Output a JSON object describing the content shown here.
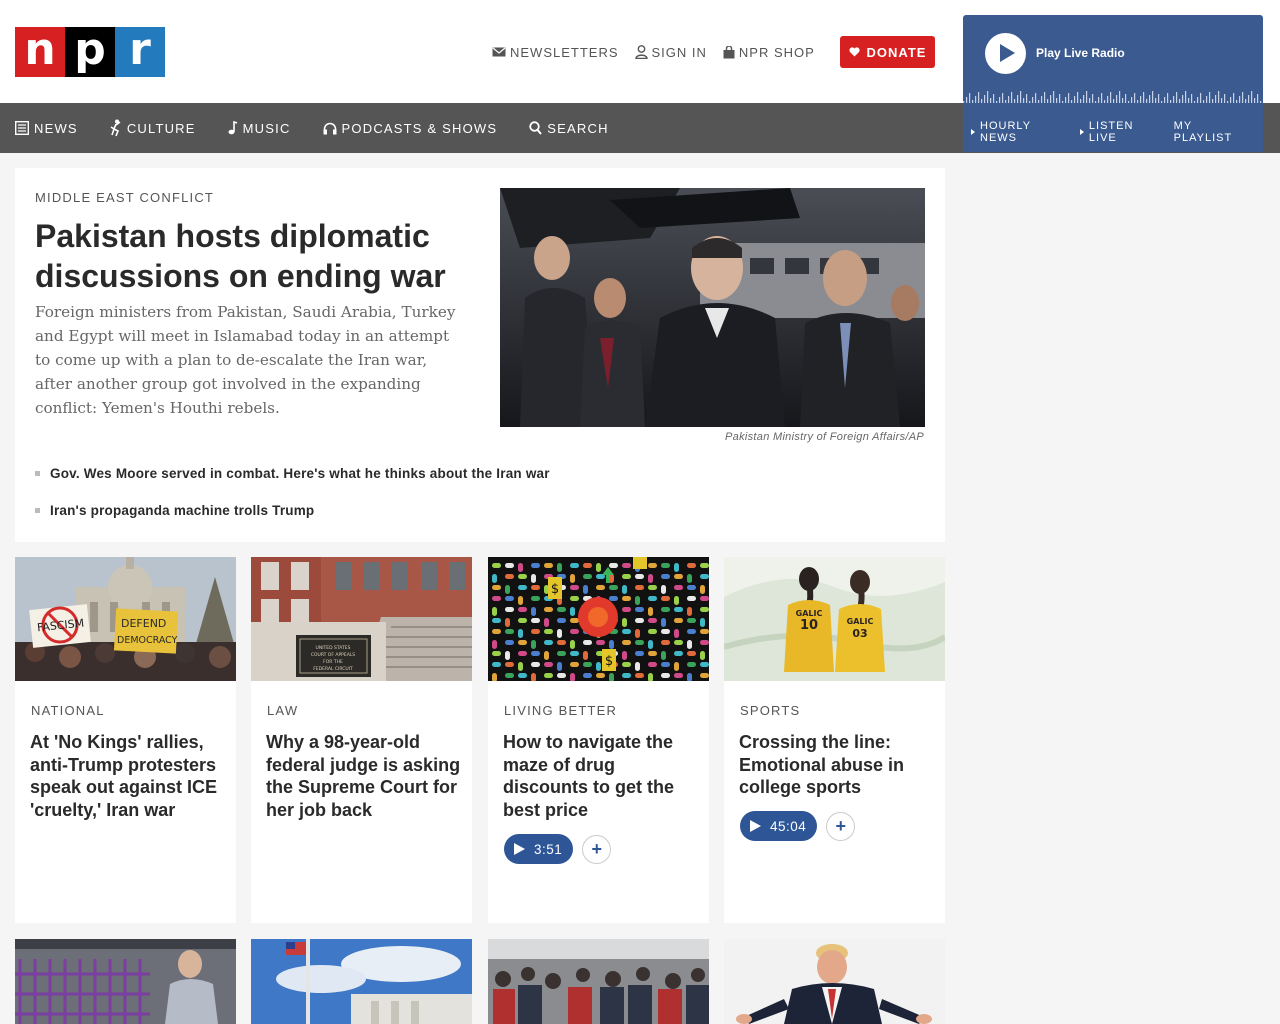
{
  "brand": {
    "logo_letters": [
      "n",
      "p",
      "r"
    ],
    "colors": {
      "red": "#d62021",
      "black": "#000000",
      "blue": "#237bbd",
      "nav_bg": "#555555",
      "player_bg": "#3b5a8f",
      "audio_btn": "#2e5697"
    }
  },
  "header": {
    "links": [
      {
        "label": "NEWSLETTERS",
        "icon": "envelope-icon"
      },
      {
        "label": "SIGN IN",
        "icon": "user-icon"
      },
      {
        "label": "NPR SHOP",
        "icon": "shopping-bag-icon"
      }
    ],
    "donate_label": "DONATE",
    "donate_icon": "heart-icon"
  },
  "player": {
    "label": "Play Live Radio",
    "links": [
      "HOURLY NEWS",
      "LISTEN LIVE",
      "MY PLAYLIST"
    ]
  },
  "nav": {
    "items": [
      {
        "label": "NEWS",
        "icon": "news-icon"
      },
      {
        "label": "CULTURE",
        "icon": "culture-icon"
      },
      {
        "label": "MUSIC",
        "icon": "music-note-icon"
      },
      {
        "label": "PODCASTS & SHOWS",
        "icon": "headphones-icon"
      },
      {
        "label": "SEARCH",
        "icon": "search-icon"
      }
    ]
  },
  "feature": {
    "kicker": "MIDDLE EAST CONFLICT",
    "title": "Pakistan hosts diplomatic discussions on ending war",
    "teaser": "Foreign ministers from Pakistan, Saudi Arabia, Turkey and Egypt will meet in Islamabad today in an attempt to come up with a plan to de-escalate the Iran war, after another group got involved in the expanding conflict: Yemen's Houthi rebels.",
    "image_credit": "Pakistan Ministry of Foreign Affairs/AP",
    "related": [
      "Gov. Wes Moore served in combat. Here's what he thinks about the Iran war",
      "Iran's propaganda machine trolls Trump"
    ]
  },
  "cards": [
    {
      "kicker": "NATIONAL",
      "title": "At 'No Kings' rallies, anti-Trump protesters speak out against ICE 'cruelty,' Iran war",
      "image_signs": [
        "FASCISM",
        "DEFEND",
        "DEMOCRACY"
      ]
    },
    {
      "kicker": "LAW",
      "title": "Why a 98-year-old federal judge is asking the Supreme Court for her job back",
      "image_plaque": [
        "UNITED STATES",
        "COURT OF APPEALS",
        "FOR THE",
        "FEDERAL CIRCUIT"
      ]
    },
    {
      "kicker": "LIVING BETTER",
      "title": "How to navigate the maze of drug discounts to get the best price",
      "audio": {
        "duration": "3:51"
      }
    },
    {
      "kicker": "SPORTS",
      "title": "Crossing the line: Emotional abuse in college sports",
      "audio": {
        "duration": "45:04"
      },
      "image_jerseys": [
        [
          "GALIC",
          "10"
        ],
        [
          "GALIC",
          "03"
        ]
      ]
    }
  ]
}
